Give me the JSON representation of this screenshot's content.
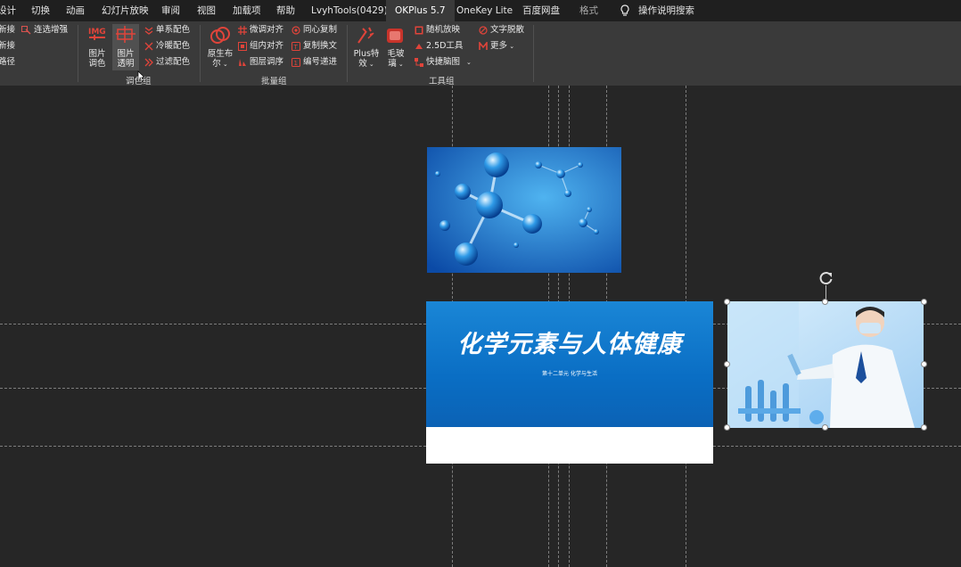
{
  "tabs": [
    {
      "label": "设计"
    },
    {
      "label": "切换"
    },
    {
      "label": "动画"
    },
    {
      "label": "幻灯片放映"
    },
    {
      "label": "审阅"
    },
    {
      "label": "视图"
    },
    {
      "label": "加载项"
    },
    {
      "label": "帮助"
    },
    {
      "label": "LvyhTools(0429)"
    },
    {
      "label": "OKPlus 5.7"
    },
    {
      "label": "OneKey Lite"
    },
    {
      "label": "百度网盘"
    },
    {
      "label": "格式"
    }
  ],
  "search": {
    "label": "操作说明搜索"
  },
  "ribbon": {
    "left_partial": [
      "新接",
      "新接",
      "路径"
    ],
    "left_select": "连选增强",
    "color_group": {
      "img_color_label": "图片\n调色",
      "img_transparent_label": "图片\n透明",
      "single_color": "单系配色",
      "cold_warm": "冷暖配色",
      "filter_color": "过滤配色",
      "label": "调色组"
    },
    "batch_group": {
      "boolean_label": "原生布\n尔",
      "fine_align": "微调对齐",
      "group_align": "组内对齐",
      "layer_order": "图层调序",
      "concentric_copy": "同心复制",
      "copy_text": "复制换文",
      "number_step": "编号递进",
      "label": "批量组"
    },
    "tool_group": {
      "plus_effect_label": "Plus特\n效",
      "glass_label": "毛玻\n璃",
      "random_zoom": "随机放映",
      "tool_25d": "2.5D工具",
      "quick_mind": "快捷脑图",
      "text_scatter": "文字脱散",
      "more": "更多",
      "label": "工具组"
    }
  },
  "slide": {
    "title": "化学元素与人体健康",
    "subtitle": "第十二单元 化学与生活"
  },
  "colors": {
    "accent": "#c0392b",
    "slide_blue": "#0a6ec4",
    "background": "#262626"
  }
}
